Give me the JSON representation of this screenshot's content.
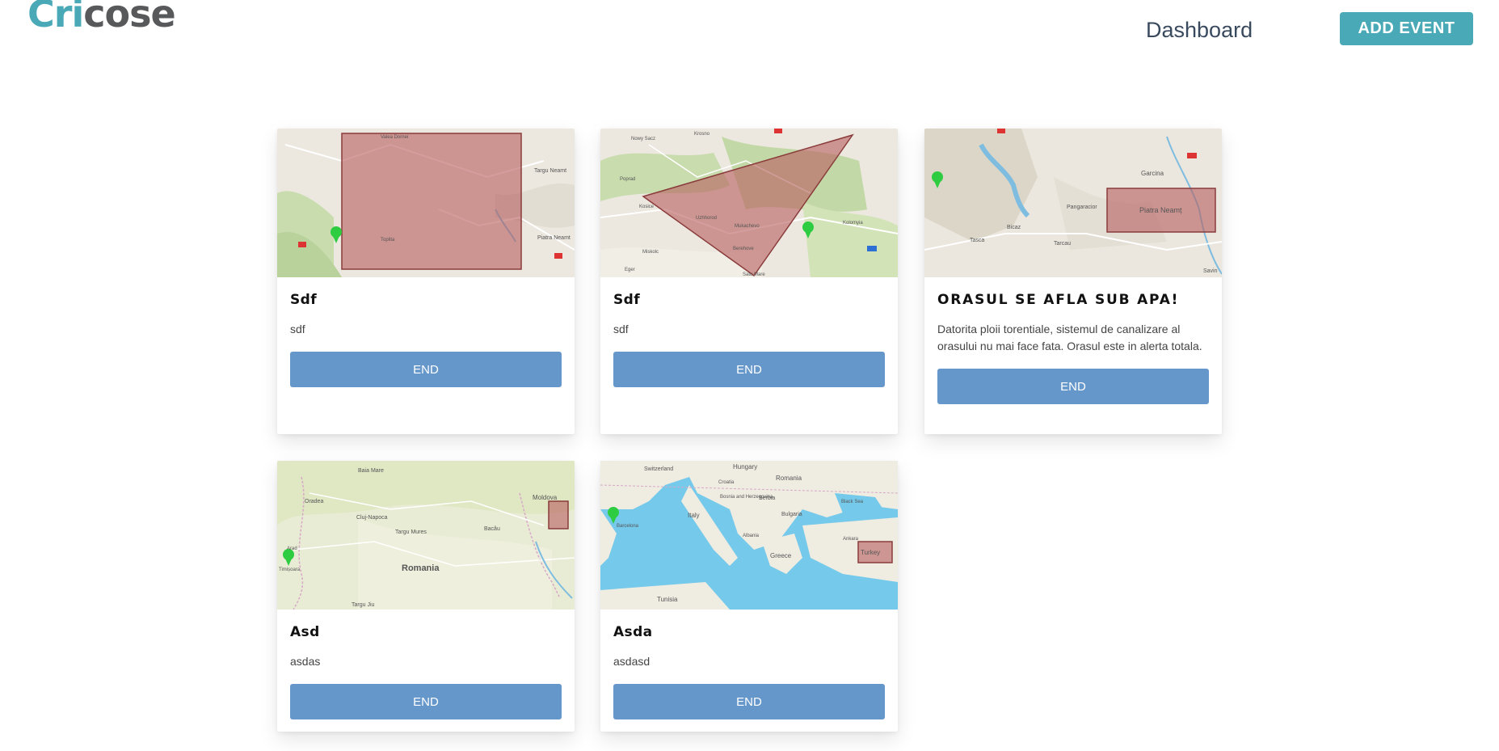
{
  "brand": {
    "part1": "Cri",
    "part2": "cose"
  },
  "nav": {
    "dashboard": "Dashboard",
    "add_event": "ADD EVENT"
  },
  "events": [
    {
      "title": "Sdf",
      "description": "sdf",
      "end_label": "END",
      "map_labels": [
        "Valea Dornei",
        "Targu Neamt",
        "Toplita",
        "Piatra Neamt"
      ]
    },
    {
      "title": "Sdf",
      "description": "sdf",
      "end_label": "END",
      "map_labels": [
        "Krosno",
        "Nowy Sacz",
        "Poprad",
        "Kosice",
        "Uzhhorod",
        "Mukachevo",
        "Berehove",
        "Miskolc",
        "Kolomyia",
        "Satu Mare",
        "Eger"
      ]
    },
    {
      "title": "ORASUL SE AFLA SUB APA!",
      "description": "Datorita ploii torentiale, sistemul de canalizare al orasului nu mai face fata. Orasul este in alerta totala.",
      "end_label": "END",
      "map_labels": [
        "Garcina",
        "Pangaracior",
        "Bicaz",
        "Piatra Neamț",
        "Tarcau",
        "Tasca",
        "Savin"
      ]
    },
    {
      "title": "Asd",
      "description": "asdas",
      "end_label": "END",
      "map_labels": [
        "Baia Mare",
        "Oradea",
        "Cluj-Napoca",
        "Targu Mures",
        "Bacău",
        "Moldova",
        "Romania",
        "Timișoara",
        "Arad",
        "Targu Jiu"
      ]
    },
    {
      "title": "Asda",
      "description": "asdasd",
      "end_label": "END",
      "map_labels": [
        "Switzerland",
        "Hungary",
        "Romania",
        "Croatia",
        "Bosnia and Herzegovina",
        "Serbia",
        "Bulgaria",
        "Italy",
        "Albania",
        "Greece",
        "Turkey",
        "Tunisia",
        "Black Sea",
        "Ankara",
        "Barcelona"
      ]
    }
  ]
}
